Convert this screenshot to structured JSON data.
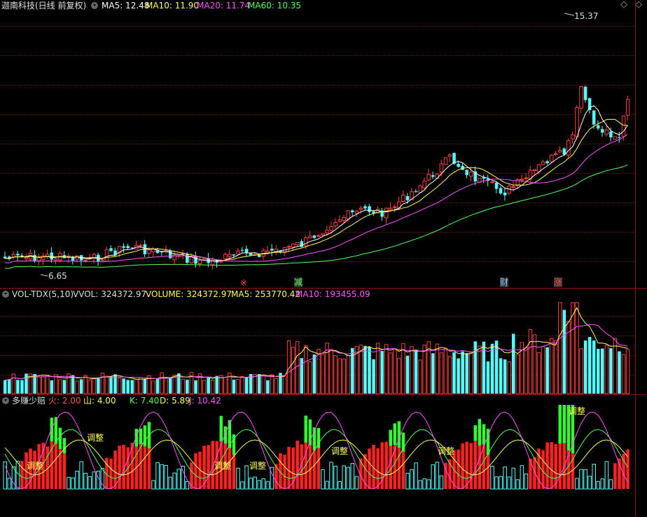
{
  "header": {
    "stock": "迦南科技(日线 前复权)",
    "ma5": "MA5: 12.48",
    "ma10": "MA10: 11.90",
    "ma20": "MA20: 11.74",
    "ma60": "MA60: 10.35"
  },
  "price_panel": {
    "high_label": "15.37",
    "low_label": "6.65",
    "event_markers": [
      "※",
      "减",
      "财",
      "涨"
    ]
  },
  "volume_panel": {
    "indicator": "VOL-TDX(5,10)",
    "vvol": "VVOL: 324372.97",
    "volume": "VOLUME: 324372.97",
    "ma5": "MA5: 253770.42",
    "ma10": "MA10: 193455.09"
  },
  "osc_panel": {
    "indicator": "多赚少赔",
    "fire": "火: 2.00",
    "mountain": "山: 4.00",
    "k": "K: 7.40",
    "d": "D: 5.89",
    "j": "J: 10.42",
    "adjust_label": "调整"
  },
  "colors": {
    "up": "#ff4040",
    "down": "#54ffff",
    "ma5": "#ffffff",
    "ma10": "#ffff54",
    "ma20": "#ff54ff",
    "ma60": "#54ff54",
    "grid": "#6a1010"
  },
  "icons": [
    "chevron-down-icon",
    "diamond-icon"
  ]
}
